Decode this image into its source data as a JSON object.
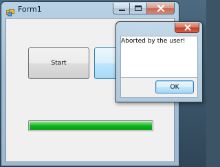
{
  "window": {
    "title": "Form1",
    "icon": "app-icon",
    "caption_buttons": [
      "minimize-icon",
      "maximize-icon",
      "close-icon"
    ]
  },
  "form": {
    "start_label": "Start",
    "stop_label": "",
    "progress": {
      "fraction": 1.0,
      "color": "#06b025"
    }
  },
  "message_box": {
    "message": "Aborted by the user!",
    "ok_label": "OK",
    "close_icon": "close-icon"
  }
}
